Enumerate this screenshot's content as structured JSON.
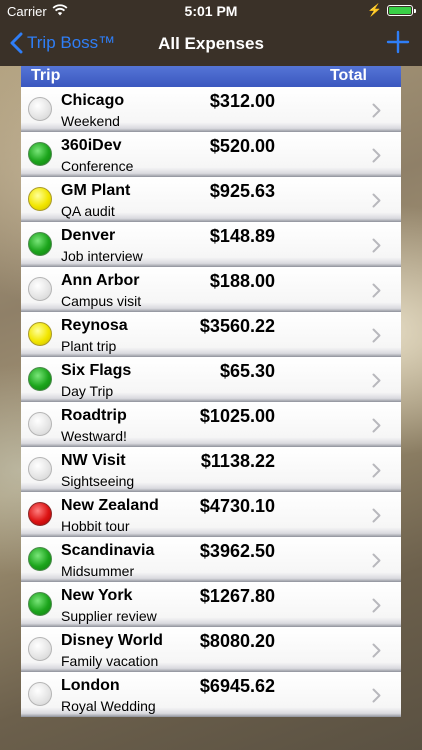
{
  "status_bar": {
    "carrier": "Carrier",
    "time": "5:01 PM"
  },
  "nav": {
    "back_label": "Trip Boss™",
    "title": "All Expenses"
  },
  "table": {
    "header": {
      "trip": "Trip",
      "total": "Total"
    },
    "rows": [
      {
        "name": "Chicago",
        "desc": "Weekend",
        "total": "$312.00",
        "status": "none"
      },
      {
        "name": "360iDev",
        "desc": "Conference",
        "total": "$520.00",
        "status": "green"
      },
      {
        "name": "GM Plant",
        "desc": "QA audit",
        "total": "$925.63",
        "status": "yellow"
      },
      {
        "name": "Denver",
        "desc": "Job interview",
        "total": "$148.89",
        "status": "green"
      },
      {
        "name": "Ann Arbor",
        "desc": "Campus visit",
        "total": "$188.00",
        "status": "none"
      },
      {
        "name": "Reynosa",
        "desc": "Plant trip",
        "total": "$3560.22",
        "status": "yellow"
      },
      {
        "name": "Six Flags",
        "desc": "Day Trip",
        "total": "$65.30",
        "status": "green"
      },
      {
        "name": "Roadtrip",
        "desc": "Westward!",
        "total": "$1025.00",
        "status": "none"
      },
      {
        "name": "NW Visit",
        "desc": "Sightseeing",
        "total": "$1138.22",
        "status": "none"
      },
      {
        "name": "New Zealand",
        "desc": "Hobbit tour",
        "total": "$4730.10",
        "status": "red"
      },
      {
        "name": "Scandinavia",
        "desc": "Midsummer",
        "total": "$3962.50",
        "status": "green"
      },
      {
        "name": "New York",
        "desc": "Supplier review",
        "total": "$1267.80",
        "status": "green"
      },
      {
        "name": "Disney World",
        "desc": "Family vacation",
        "total": "$8080.20",
        "status": "none"
      },
      {
        "name": "London",
        "desc": "Royal Wedding",
        "total": "$6945.62",
        "status": "none"
      }
    ]
  },
  "colors": {
    "accent": "#2f7ef6",
    "header_blue": "#4464cc",
    "nav_background": "#3a3128"
  },
  "icons": {
    "back": "chevron-left-icon",
    "add": "plus-icon",
    "row": "chevron-right-icon",
    "wifi": "wifi-icon",
    "battery": "battery-icon"
  }
}
